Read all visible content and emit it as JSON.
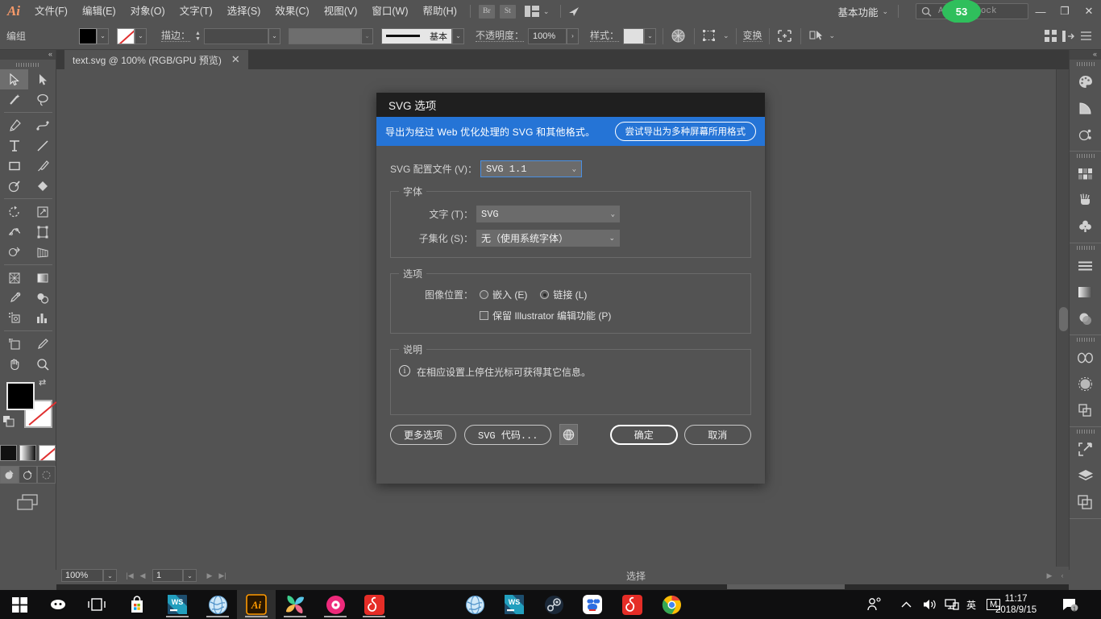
{
  "app": {
    "name": "Adobe Illustrator",
    "logo": "Ai",
    "workspace": "基本功能",
    "menus": [
      "文件(F)",
      "编辑(E)",
      "对象(O)",
      "文字(T)",
      "选择(S)",
      "效果(C)",
      "视图(V)",
      "窗口(W)",
      "帮助(H)"
    ],
    "bridge_button": "Br",
    "stock_button": "St",
    "stock_search_placeholder": "Adobe Stock",
    "notification_count": "53",
    "window_buttons": {
      "minimize": "—",
      "restore": "❐",
      "close": "✕"
    }
  },
  "controlbar": {
    "selection_label": "编组",
    "stroke_label": "描边：",
    "stroke_width": "",
    "stroke_profile": "",
    "brush_label": "基本",
    "opacity_label": "不透明度：",
    "opacity_value": "100%",
    "style_label": "样式：",
    "transform_label": "变换"
  },
  "tab": {
    "title": "text.svg @ 100% (RGB/GPU 预览)",
    "close": "✕"
  },
  "statusbar": {
    "zoom": "100%",
    "artboard": "1",
    "tool_status": "选择"
  },
  "dialog": {
    "title": "SVG 选项",
    "banner": {
      "text": "导出为经过 Web 优化处理的 SVG 和其他格式。",
      "button": "尝试导出为多种屏幕所用格式",
      "color": "#2574d6"
    },
    "profile": {
      "label": "SVG 配置文件 (V)：",
      "value": "SVG 1.1"
    },
    "fonts": {
      "legend": "字体",
      "type": {
        "label": "文字 (T)：",
        "value": "SVG"
      },
      "subsetting": {
        "label": "子集化 (S)：",
        "value": "无（使用系统字体）"
      }
    },
    "options": {
      "legend": "选项",
      "image_location": {
        "label": "图像位置：",
        "embed": "嵌入 (E)",
        "link": "链接 (L)",
        "selected": "link"
      },
      "preserve_editing": {
        "label": "保留 Illustrator 编辑功能 (P)",
        "checked": false
      }
    },
    "description": {
      "legend": "说明",
      "text": "在相应设置上停住光标可获得其它信息。",
      "info_icon": "i"
    },
    "buttons": {
      "more_options": "更多选项",
      "svg_code": "SVG 代码...",
      "globe": "globe-icon",
      "ok": "确定",
      "cancel": "取消"
    }
  },
  "taskbar": {
    "items": [
      {
        "name": "start-button",
        "label": "Windows"
      },
      {
        "name": "cortana-button",
        "label": "Cortana"
      },
      {
        "name": "task-view-button",
        "label": "Task View"
      },
      {
        "name": "store-button",
        "label": "Microsoft Store"
      },
      {
        "name": "webstorm-button",
        "label": "WebStorm"
      },
      {
        "name": "browser-button",
        "label": "Browser"
      },
      {
        "name": "illustrator-button",
        "label": "Adobe Illustrator"
      },
      {
        "name": "photos-button",
        "label": "Photos"
      },
      {
        "name": "music-button",
        "label": "Music"
      },
      {
        "name": "netease-button",
        "label": "NetEase Music"
      }
    ],
    "tray": {
      "language": "英",
      "ime": "M",
      "time": "11:17",
      "date": "2018/9/15",
      "notification_count": "1"
    }
  }
}
